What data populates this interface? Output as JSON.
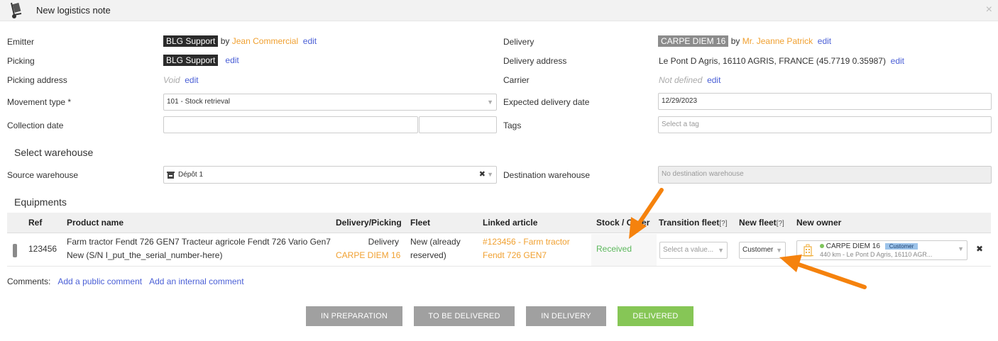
{
  "window": {
    "title": "New logistics note",
    "close_glyph": "×"
  },
  "form": {
    "by_word": "by",
    "edit_label": "edit",
    "emitter": {
      "label": "Emitter",
      "badge": "BLG Support",
      "person": "Jean Commercial"
    },
    "picking": {
      "label": "Picking",
      "badge": "BLG Support"
    },
    "picking_address": {
      "label": "Picking address",
      "value": "Void"
    },
    "movement_type": {
      "label": "Movement type *",
      "value": "101 - Stock retrieval"
    },
    "collection_date": {
      "label": "Collection date",
      "date_value": "",
      "time_value": ""
    },
    "delivery": {
      "label": "Delivery",
      "badge": "CARPE DIEM 16",
      "person": "Mr. Jeanne Patrick"
    },
    "delivery_address": {
      "label": "Delivery address",
      "value": "Le Pont D Agris, 16110 AGRIS, FRANCE (45.7719 0.35987)"
    },
    "carrier": {
      "label": "Carrier",
      "value": "Not defined"
    },
    "expected_delivery_date": {
      "label": "Expected delivery date",
      "value": "12/29/2023"
    },
    "tags": {
      "label": "Tags",
      "placeholder": "Select a tag"
    }
  },
  "warehouse": {
    "heading": "Select warehouse",
    "source": {
      "label": "Source warehouse",
      "value": "Dépôt 1",
      "clear_glyph": "✖"
    },
    "destination": {
      "label": "Destination warehouse",
      "placeholder": "No destination warehouse"
    }
  },
  "equipments": {
    "heading": "Equipments",
    "columns": {
      "ref": "Ref",
      "product": "Product name",
      "delivery_picking": "Delivery/Picking",
      "fleet": "Fleet",
      "linked_article": "Linked article",
      "stock_order": "Stock / Order",
      "transition_fleet": "Transition fleet",
      "new_fleet": "New fleet",
      "new_owner": "New owner",
      "help": "[?]"
    },
    "row": {
      "ref": "123456",
      "product_line1": "Farm tractor Fendt 726 GEN7 Tracteur agricole Fendt 726 Vario Gen7",
      "product_line2": "New (S/N I_put_the_serial_number-here)",
      "delivery_type": "Delivery",
      "delivery_target": "CARPE DIEM 16",
      "fleet_line1": "New (already",
      "fleet_line2": "reserved)",
      "article_line1": "#123456 - Farm tractor",
      "article_line2": "Fendt 726 GEN7",
      "stock_status": "Received",
      "transition_placeholder": "Select a value...",
      "new_fleet_value": "Customer",
      "owner_name": "CARPE DIEM 16",
      "owner_badge": "Customer",
      "owner_detail": "440 km - Le Pont D Agris, 16110 AGR...",
      "remove_glyph": "✖"
    }
  },
  "comments": {
    "label": "Comments:",
    "add_public": "Add a public comment",
    "add_internal": "Add an internal comment"
  },
  "status_buttons": [
    {
      "label": "IN PREPARATION",
      "active": false
    },
    {
      "label": "TO BE DELIVERED",
      "active": false
    },
    {
      "label": "IN DELIVERY",
      "active": false
    },
    {
      "label": "DELIVERED",
      "active": true
    }
  ],
  "colors": {
    "accent_orange": "#f0a030",
    "link_blue": "#4a5fd6",
    "success_green": "#86c656",
    "annotation_arrow": "#f5820d"
  },
  "icons": [
    "hand-truck-icon",
    "close-icon",
    "warehouse-icon",
    "chevron-down-icon",
    "building-icon",
    "drag-handle-icon",
    "arrow-annotation-icon"
  ]
}
